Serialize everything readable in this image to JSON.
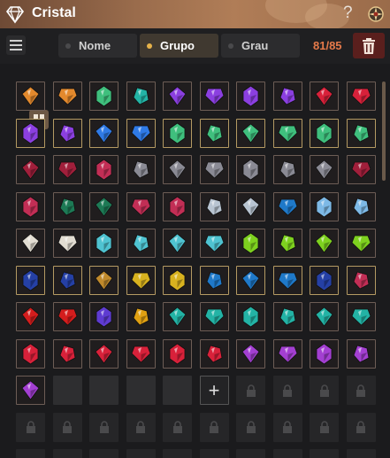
{
  "window": {
    "title": "Cristal"
  },
  "toolbar": {
    "sort_options": [
      {
        "label": "Nome",
        "active": false
      },
      {
        "label": "Grupo",
        "active": true
      },
      {
        "label": "Grau",
        "active": false
      }
    ],
    "count": "81/85"
  },
  "gem_colors": {
    "orange": "#e3892d",
    "emerald": "#3fbf7d",
    "violet": "#8b3fe0",
    "red": "#d8213a",
    "blue": "#2f7ae6",
    "teal": "#23b3a5",
    "crimson": "#a11f3b",
    "rose": "#c22e55",
    "silver": "#b8c4d1",
    "gray": "#8a8a94",
    "green_dark": "#1d7a55",
    "ice": "#7db9e6",
    "white": "#e2ddd2",
    "cyan": "#4fc3d1",
    "lime": "#7ed11f",
    "yellow": "#d8b21f",
    "gold": "#c08a2c",
    "amber": "#e0a012",
    "sky": "#1f79c9",
    "navy": "#2540a5",
    "magenta": "#a33fd1",
    "ruby": "#d41d1d",
    "purple": "#5e3bd1"
  },
  "rows": [
    [
      "orange",
      "orange",
      "emerald",
      "teal",
      "violet",
      "violet",
      "violet",
      "violet",
      "red",
      "red"
    ],
    [
      "violet",
      "violet",
      "blue",
      "blue",
      "emerald",
      "emerald",
      "emerald",
      "emerald",
      "emerald",
      "emerald"
    ],
    [
      "crimson",
      "crimson",
      "rose",
      "gray",
      "gray",
      "gray",
      "gray",
      "gray",
      "gray",
      "crimson"
    ],
    [
      "rose",
      "green_dark",
      "green_dark",
      "rose",
      "rose",
      "silver",
      "silver",
      "sky",
      "ice",
      "ice"
    ],
    [
      "white",
      "white",
      "cyan",
      "cyan",
      "cyan",
      "cyan",
      "lime",
      "lime",
      "lime",
      "lime"
    ],
    [
      "navy",
      "navy",
      "gold",
      "yellow",
      "yellow",
      "sky",
      "sky",
      "sky",
      "navy",
      "rose"
    ],
    [
      "ruby",
      "ruby",
      "purple",
      "amber",
      "teal",
      "teal",
      "teal",
      "teal",
      "teal",
      "teal"
    ],
    [
      "red",
      "red",
      "red",
      "red",
      "red",
      "red",
      "magenta",
      "magenta",
      "magenta",
      "magenta"
    ],
    [
      "magenta"
    ]
  ],
  "lit_rows": [
    1,
    5
  ],
  "empty_slots": 4,
  "add_slot_label": "+",
  "locked_rows": 2
}
